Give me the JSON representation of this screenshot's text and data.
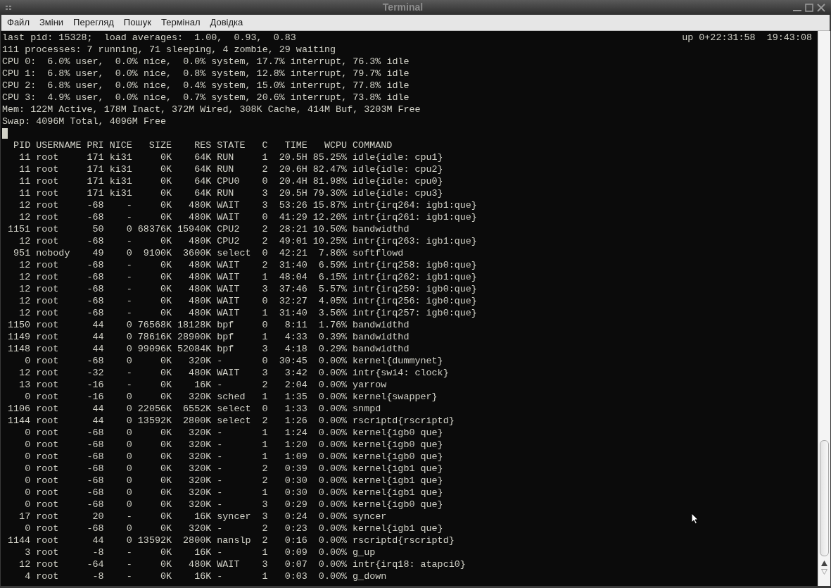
{
  "window": {
    "title": "Terminal"
  },
  "menu": [
    "Файл",
    "Зміни",
    "Перегляд",
    "Пошук",
    "Термінал",
    "Довідка"
  ],
  "terminal": {
    "first_line": "last pid: 15328;  load averages:  1.00,  0.93,  0.83",
    "uptime": "up 0+22:31:58  19:43:08",
    "summary_lines": [
      "111 processes: 7 running, 71 sleeping, 4 zombie, 29 waiting",
      "CPU 0:  6.0% user,  0.0% nice,  0.0% system, 17.7% interrupt, 76.3% idle",
      "CPU 1:  6.8% user,  0.0% nice,  0.8% system, 12.8% interrupt, 79.7% idle",
      "CPU 2:  6.8% user,  0.0% nice,  0.4% system, 15.0% interrupt, 77.8% idle",
      "CPU 3:  4.9% user,  0.0% nice,  0.7% system, 20.6% interrupt, 73.8% idle",
      "Mem: 122M Active, 178M Inact, 372M Wired, 308K Cache, 414M Buf, 3203M Free",
      "Swap: 4096M Total, 4096M Free"
    ],
    "table": {
      "columns": [
        "PID",
        "USERNAME",
        "PRI",
        "NICE",
        "SIZE",
        "RES",
        "STATE",
        "C",
        "TIME",
        "WCPU",
        "COMMAND"
      ],
      "rows": [
        [
          "11",
          "root",
          "171",
          "ki31",
          "0K",
          "64K",
          "RUN",
          "1",
          "20.5H",
          "85.25%",
          "idle{idle: cpu1}"
        ],
        [
          "11",
          "root",
          "171",
          "ki31",
          "0K",
          "64K",
          "RUN",
          "2",
          "20.6H",
          "82.47%",
          "idle{idle: cpu2}"
        ],
        [
          "11",
          "root",
          "171",
          "ki31",
          "0K",
          "64K",
          "CPU0",
          "0",
          "20.4H",
          "81.98%",
          "idle{idle: cpu0}"
        ],
        [
          "11",
          "root",
          "171",
          "ki31",
          "0K",
          "64K",
          "RUN",
          "3",
          "20.5H",
          "79.30%",
          "idle{idle: cpu3}"
        ],
        [
          "12",
          "root",
          "-68",
          "-",
          "0K",
          "480K",
          "WAIT",
          "3",
          "53:26",
          "15.87%",
          "intr{irq264: igb1:que}"
        ],
        [
          "12",
          "root",
          "-68",
          "-",
          "0K",
          "480K",
          "WAIT",
          "0",
          "41:29",
          "12.26%",
          "intr{irq261: igb1:que}"
        ],
        [
          "1151",
          "root",
          "50",
          "0",
          "68376K",
          "15940K",
          "CPU2",
          "2",
          "28:21",
          "10.50%",
          "bandwidthd"
        ],
        [
          "12",
          "root",
          "-68",
          "-",
          "0K",
          "480K",
          "CPU2",
          "2",
          "49:01",
          "10.25%",
          "intr{irq263: igb1:que}"
        ],
        [
          "951",
          "nobody",
          "49",
          "0",
          "9100K",
          "3600K",
          "select",
          "0",
          "42:21",
          "7.86%",
          "softflowd"
        ],
        [
          "12",
          "root",
          "-68",
          "-",
          "0K",
          "480K",
          "WAIT",
          "2",
          "31:40",
          "6.59%",
          "intr{irq258: igb0:que}"
        ],
        [
          "12",
          "root",
          "-68",
          "-",
          "0K",
          "480K",
          "WAIT",
          "1",
          "48:04",
          "6.15%",
          "intr{irq262: igb1:que}"
        ],
        [
          "12",
          "root",
          "-68",
          "-",
          "0K",
          "480K",
          "WAIT",
          "3",
          "37:46",
          "5.57%",
          "intr{irq259: igb0:que}"
        ],
        [
          "12",
          "root",
          "-68",
          "-",
          "0K",
          "480K",
          "WAIT",
          "0",
          "32:27",
          "4.05%",
          "intr{irq256: igb0:que}"
        ],
        [
          "12",
          "root",
          "-68",
          "-",
          "0K",
          "480K",
          "WAIT",
          "1",
          "31:40",
          "3.56%",
          "intr{irq257: igb0:que}"
        ],
        [
          "1150",
          "root",
          "44",
          "0",
          "76568K",
          "18128K",
          "bpf",
          "0",
          "8:11",
          "1.76%",
          "bandwidthd"
        ],
        [
          "1149",
          "root",
          "44",
          "0",
          "78616K",
          "28900K",
          "bpf",
          "1",
          "4:33",
          "0.39%",
          "bandwidthd"
        ],
        [
          "1148",
          "root",
          "44",
          "0",
          "99096K",
          "52084K",
          "bpf",
          "3",
          "4:18",
          "0.29%",
          "bandwidthd"
        ],
        [
          "0",
          "root",
          "-68",
          "0",
          "0K",
          "320K",
          "-",
          "0",
          "30:45",
          "0.00%",
          "kernel{dummynet}"
        ],
        [
          "12",
          "root",
          "-32",
          "-",
          "0K",
          "480K",
          "WAIT",
          "3",
          "3:42",
          "0.00%",
          "intr{swi4: clock}"
        ],
        [
          "13",
          "root",
          "-16",
          "-",
          "0K",
          "16K",
          "-",
          "2",
          "2:04",
          "0.00%",
          "yarrow"
        ],
        [
          "0",
          "root",
          "-16",
          "0",
          "0K",
          "320K",
          "sched",
          "1",
          "1:35",
          "0.00%",
          "kernel{swapper}"
        ],
        [
          "1106",
          "root",
          "44",
          "0",
          "22056K",
          "6552K",
          "select",
          "0",
          "1:33",
          "0.00%",
          "snmpd"
        ],
        [
          "1144",
          "root",
          "44",
          "0",
          "13592K",
          "2800K",
          "select",
          "2",
          "1:26",
          "0.00%",
          "rscriptd{rscriptd}"
        ],
        [
          "0",
          "root",
          "-68",
          "0",
          "0K",
          "320K",
          "-",
          "1",
          "1:24",
          "0.00%",
          "kernel{igb0 que}"
        ],
        [
          "0",
          "root",
          "-68",
          "0",
          "0K",
          "320K",
          "-",
          "1",
          "1:20",
          "0.00%",
          "kernel{igb0 que}"
        ],
        [
          "0",
          "root",
          "-68",
          "0",
          "0K",
          "320K",
          "-",
          "1",
          "1:09",
          "0.00%",
          "kernel{igb0 que}"
        ],
        [
          "0",
          "root",
          "-68",
          "0",
          "0K",
          "320K",
          "-",
          "2",
          "0:39",
          "0.00%",
          "kernel{igb1 que}"
        ],
        [
          "0",
          "root",
          "-68",
          "0",
          "0K",
          "320K",
          "-",
          "2",
          "0:30",
          "0.00%",
          "kernel{igb1 que}"
        ],
        [
          "0",
          "root",
          "-68",
          "0",
          "0K",
          "320K",
          "-",
          "1",
          "0:30",
          "0.00%",
          "kernel{igb1 que}"
        ],
        [
          "0",
          "root",
          "-68",
          "0",
          "0K",
          "320K",
          "-",
          "3",
          "0:29",
          "0.00%",
          "kernel{igb0 que}"
        ],
        [
          "17",
          "root",
          "20",
          "-",
          "0K",
          "16K",
          "syncer",
          "3",
          "0:24",
          "0.00%",
          "syncer"
        ],
        [
          "0",
          "root",
          "-68",
          "0",
          "0K",
          "320K",
          "-",
          "2",
          "0:23",
          "0.00%",
          "kernel{igb1 que}"
        ],
        [
          "1144",
          "root",
          "44",
          "0",
          "13592K",
          "2800K",
          "nanslp",
          "2",
          "0:16",
          "0.00%",
          "rscriptd{rscriptd}"
        ],
        [
          "3",
          "root",
          "-8",
          "-",
          "0K",
          "16K",
          "-",
          "1",
          "0:09",
          "0.00%",
          "g_up"
        ],
        [
          "12",
          "root",
          "-64",
          "-",
          "0K",
          "480K",
          "WAIT",
          "3",
          "0:07",
          "0.00%",
          "intr{irq18: atapci0}"
        ],
        [
          "4",
          "root",
          "-8",
          "-",
          "0K",
          "16K",
          "-",
          "1",
          "0:03",
          "0.00%",
          "g_down"
        ]
      ]
    }
  }
}
